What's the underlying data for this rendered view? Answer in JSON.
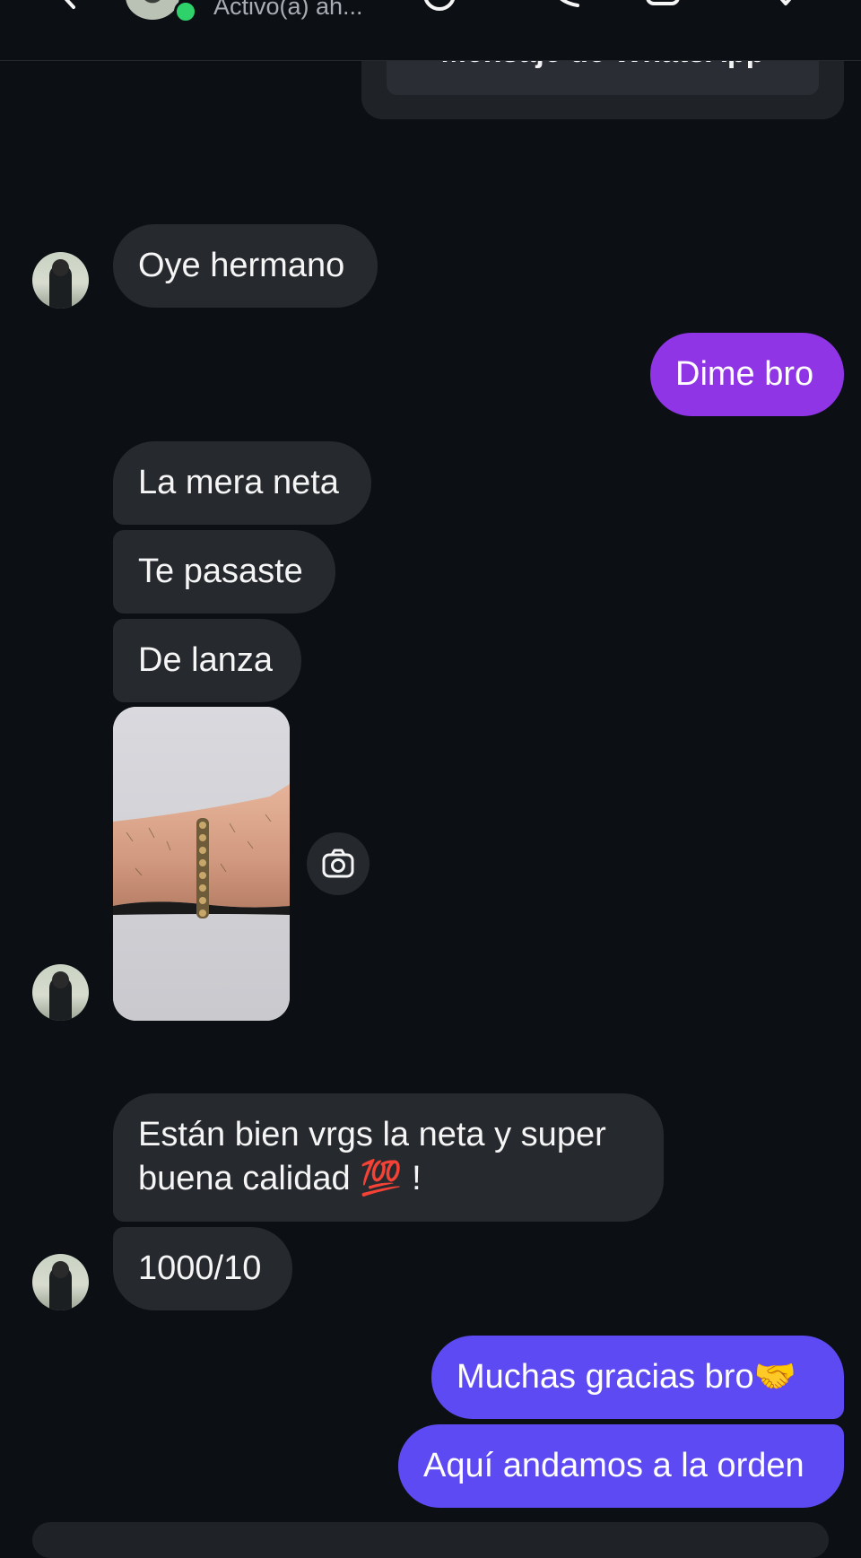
{
  "header": {
    "status": "Activo(a) ah..."
  },
  "whatsapp_card": {
    "label": "Mensaje de WhatsApp"
  },
  "messages": {
    "m1": "Oye hermano",
    "m2": "Dime bro",
    "m3": "La mera neta",
    "m4": "Te pasaste",
    "m5": "De lanza",
    "m6_line1": "Están bien vrgs la neta y super",
    "m6_line2": "buena calidad 💯 !",
    "m7": "1000/10",
    "m8": "Muchas gracias bro🤝",
    "m9": "Aquí andamos a la orden"
  },
  "colors": {
    "background": "#0c1014",
    "incoming_bubble": "#26292e",
    "outgoing_purple": "#8f35e6",
    "outgoing_indigo": "#5d4af2",
    "online": "#2fd26a"
  },
  "icons": {
    "back": "back-arrow-icon",
    "call": "phone-icon",
    "video": "video-icon",
    "tag": "tag-icon",
    "info": "info-icon",
    "camera": "camera-icon"
  }
}
